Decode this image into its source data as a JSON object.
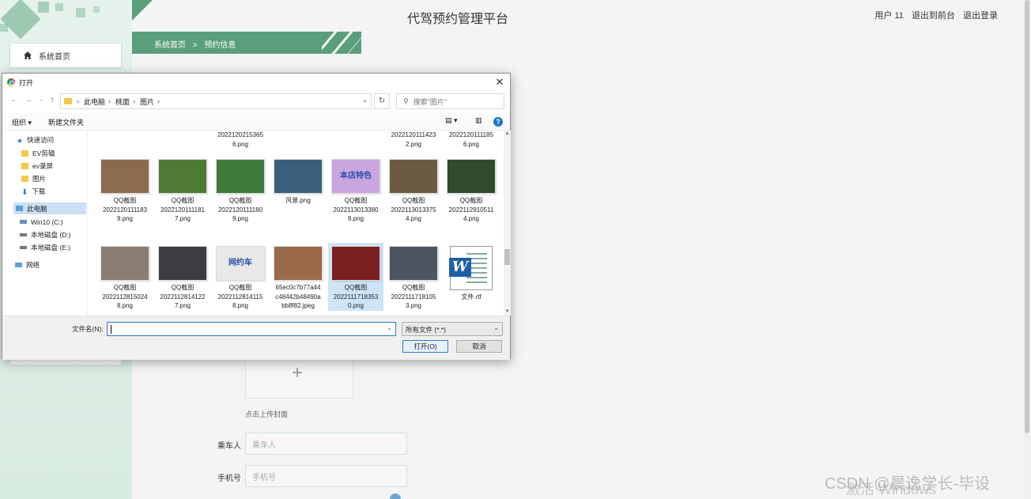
{
  "colors": {
    "accent": "#5a9e7b",
    "sidebar_bg": "#e6f2ec",
    "dialog_selection": "#cce0f5",
    "link_blue": "#2a7ad4"
  },
  "app": {
    "title": "代驾预约管理平台"
  },
  "top_links": {
    "user": "用户 11",
    "to_frontend": "退出到前台",
    "logout": "退出登录"
  },
  "sidebar": {
    "items": [
      {
        "label": "系统首页",
        "icon": "home-icon"
      }
    ]
  },
  "breadcrumb": {
    "home": "系统首页",
    "sep": ">",
    "current": "预约信息"
  },
  "form": {
    "upload_hint": "点击上传封面",
    "upload_icon": "plus-icon",
    "passenger_label": "乘车人",
    "passenger_placeholder": "乘车人",
    "phone_label": "手机号",
    "phone_placeholder": "手机号"
  },
  "dialog": {
    "title": "打开",
    "close_icon": "close-icon",
    "address": {
      "parts": [
        "此电脑",
        "桃面",
        "图片"
      ]
    },
    "search_placeholder": "搜索\"图片\"",
    "toolbar": {
      "organize": "组织 ▾",
      "new_folder": "新建文件夹"
    },
    "nav": [
      {
        "label": "快速访问",
        "icon": "star-icon"
      },
      {
        "label": "EV剪辑",
        "icon": "folder-icon"
      },
      {
        "label": "ev录屏",
        "icon": "folder-icon"
      },
      {
        "label": "图片",
        "icon": "folder-icon"
      },
      {
        "label": "下载",
        "icon": "download-icon"
      },
      {
        "label": "此电脑",
        "icon": "computer-icon",
        "selected": true
      },
      {
        "label": "Win10 (C:)",
        "icon": "drive-icon"
      },
      {
        "label": "本地磁盘 (D:)",
        "icon": "drive-icon"
      },
      {
        "label": "本地磁盘 (E:)",
        "icon": "drive-icon"
      },
      {
        "label": "网络",
        "icon": "network-icon"
      }
    ],
    "files_top": [
      {
        "name": "2022120215365\n6.png"
      },
      {
        "name": "2022120111423\n2.png"
      },
      {
        "name": "2022120111185\n6.png"
      }
    ],
    "files": [
      {
        "name": "QQ截图\n2022120111183\n9.png",
        "thumb": "#8a6b4e"
      },
      {
        "name": "QQ截图\n2022120111181\n7.png",
        "thumb": "#4e7a34"
      },
      {
        "name": "QQ截图\n2022120111180\n9.png",
        "thumb": "#3f7a3a"
      },
      {
        "name": "风景.png",
        "thumb": "#3a5f7a"
      },
      {
        "name": "QQ截图\n2022113013380\n8.png",
        "thumb": "#c9a6e0",
        "text": "本店特色"
      },
      {
        "name": "QQ截图\n2022113013375\n4.png",
        "thumb": "#6b5b44"
      },
      {
        "name": "QQ截图\n2022112910511\n4.png",
        "thumb": "#2f4a2d"
      },
      {
        "name": "QQ截图\n2022112815024\n8.png",
        "thumb": "#8b7d72"
      },
      {
        "name": "QQ截图\n2022112814122\n7.png",
        "thumb": "#3b3d42"
      },
      {
        "name": "QQ截图\n2022112814115\n8.png",
        "thumb": "#e8e8e8",
        "text": "网约车"
      },
      {
        "name": "65ec0c7b77a44\nc48442b48490a\nbb8f82.jpeg",
        "thumb": "#9b6a4a"
      },
      {
        "name": "QQ截图\n2022111718353\n0.png",
        "thumb": "#7a1f22",
        "selected": true
      },
      {
        "name": "QQ截图\n2022111718105\n3.png",
        "thumb": "#4d5560"
      },
      {
        "name": "文件.rtf",
        "doc": true
      }
    ],
    "filename_label": "文件名(N):",
    "filename_value": "",
    "filetype": "所有文件 (*.*)",
    "open_button": "打开(O)",
    "cancel_button": "取消"
  },
  "watermark": {
    "windows": "激活 Windows",
    "csdn": "CSDN @晨逸学长-毕设"
  }
}
